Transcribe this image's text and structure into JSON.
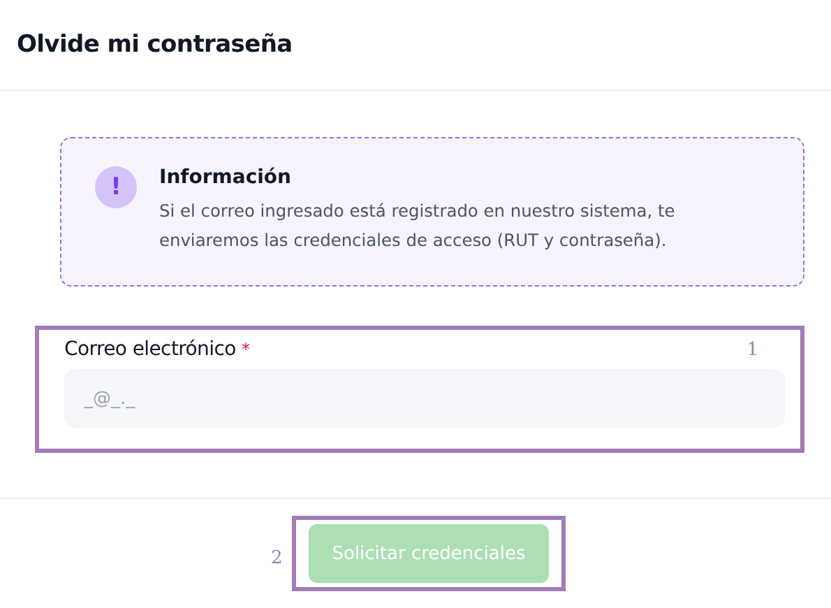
{
  "dialog": {
    "title": "Olvide mi contraseña"
  },
  "info": {
    "title": "Información",
    "icon_text": "!",
    "message": "Si el correo ingresado está registrado en nuestro sistema, te enviaremos las credenciales de acceso (RUT y contraseña)."
  },
  "email_field": {
    "label": "Correo electrónico",
    "required_mark": "*",
    "placeholder": "_@_._",
    "annotation": "1"
  },
  "submit_button": {
    "label": "Solicitar credenciales",
    "disabled": true,
    "annotation": "2"
  }
}
